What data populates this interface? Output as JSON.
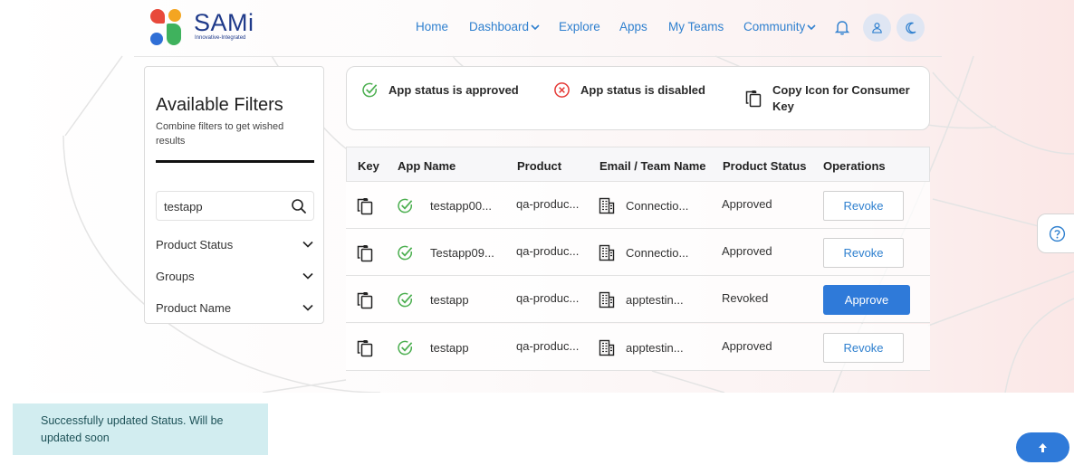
{
  "brand": {
    "name": "SAMi",
    "tagline": "Innovative-Integrated",
    "colors": {
      "red": "#e8493b",
      "orange": "#f4a521",
      "green": "#3fb25d",
      "blue": "#2f6fd6",
      "text": "#1f3a8a"
    }
  },
  "nav": {
    "items": [
      {
        "label": "Home"
      },
      {
        "label": "Dashboard",
        "dropdown": true
      },
      {
        "label": "Explore"
      },
      {
        "label": "Apps"
      },
      {
        "label": "My Teams"
      },
      {
        "label": "Community",
        "dropdown": true
      }
    ],
    "icons": [
      "bell-icon",
      "user-icon",
      "moon-icon"
    ]
  },
  "filters": {
    "title": "Available Filters",
    "subtitle": "Combine filters to get wished results",
    "search_value": "testapp",
    "groups": [
      {
        "label": "Product Status"
      },
      {
        "label": "Groups"
      },
      {
        "label": "Product Name"
      }
    ]
  },
  "legend": {
    "approved": "App status is approved",
    "disabled": "App status is disabled",
    "copy": "Copy Icon for Consumer Key"
  },
  "table": {
    "headers": {
      "key": "Key",
      "app_name": "App Name",
      "product": "Product",
      "email_team": "Email / Team Name",
      "product_status": "Product Status",
      "operations": "Operations"
    },
    "rows": [
      {
        "app_name": "testapp00...",
        "product": "qa-produc...",
        "team": "Connectio...",
        "status": "Approved",
        "action": "Revoke",
        "primary": false
      },
      {
        "app_name": "Testapp09...",
        "product": "qa-produc...",
        "team": "Connectio...",
        "status": "Approved",
        "action": "Revoke",
        "primary": false
      },
      {
        "app_name": "testapp",
        "product": "qa-produc...",
        "team": "apptestin...",
        "status": "Revoked",
        "action": "Approve",
        "primary": true
      },
      {
        "app_name": "testapp",
        "product": "qa-produc...",
        "team": "apptestin...",
        "status": "Approved",
        "action": "Revoke",
        "primary": false
      }
    ]
  },
  "toast": {
    "message": "Successfully updated Status. Will be updated soon"
  },
  "colors": {
    "link": "#2f80cf",
    "primary_button": "#2f7ad9",
    "success": "#4caf50",
    "danger": "#e53935",
    "toast_bg": "#d2edf0"
  }
}
